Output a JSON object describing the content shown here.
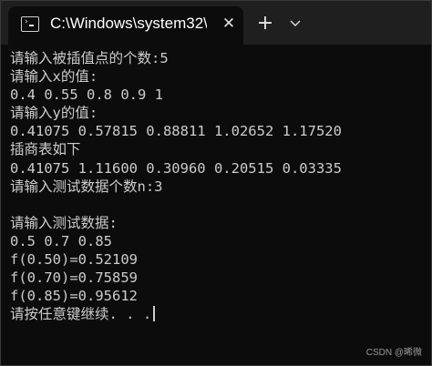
{
  "tab": {
    "icon": "terminal-icon",
    "title": "C:\\Windows\\system32\\",
    "close": "✕"
  },
  "titlebar": {
    "new_tab": "+",
    "dropdown_icon": "chevron-down-icon"
  },
  "terminal": {
    "lines": [
      "请输入被插值点的个数:5",
      "请输入x的值:",
      "0.4 0.55 0.8 0.9 1",
      "请输入y的值:",
      "0.41075 0.57815 0.88811 1.02652 1.17520",
      "插商表如下",
      "0.41075 1.11600 0.30960 0.20515 0.03335",
      "请输入测试数据个数n:3",
      "",
      "请输入测试数据:",
      "0.5 0.7 0.85",
      "f(0.50)=0.52109",
      "f(0.70)=0.75859",
      "f(0.85)=0.95612",
      "请按任意键继续. . ."
    ]
  },
  "watermark": "CSDN @晞微"
}
